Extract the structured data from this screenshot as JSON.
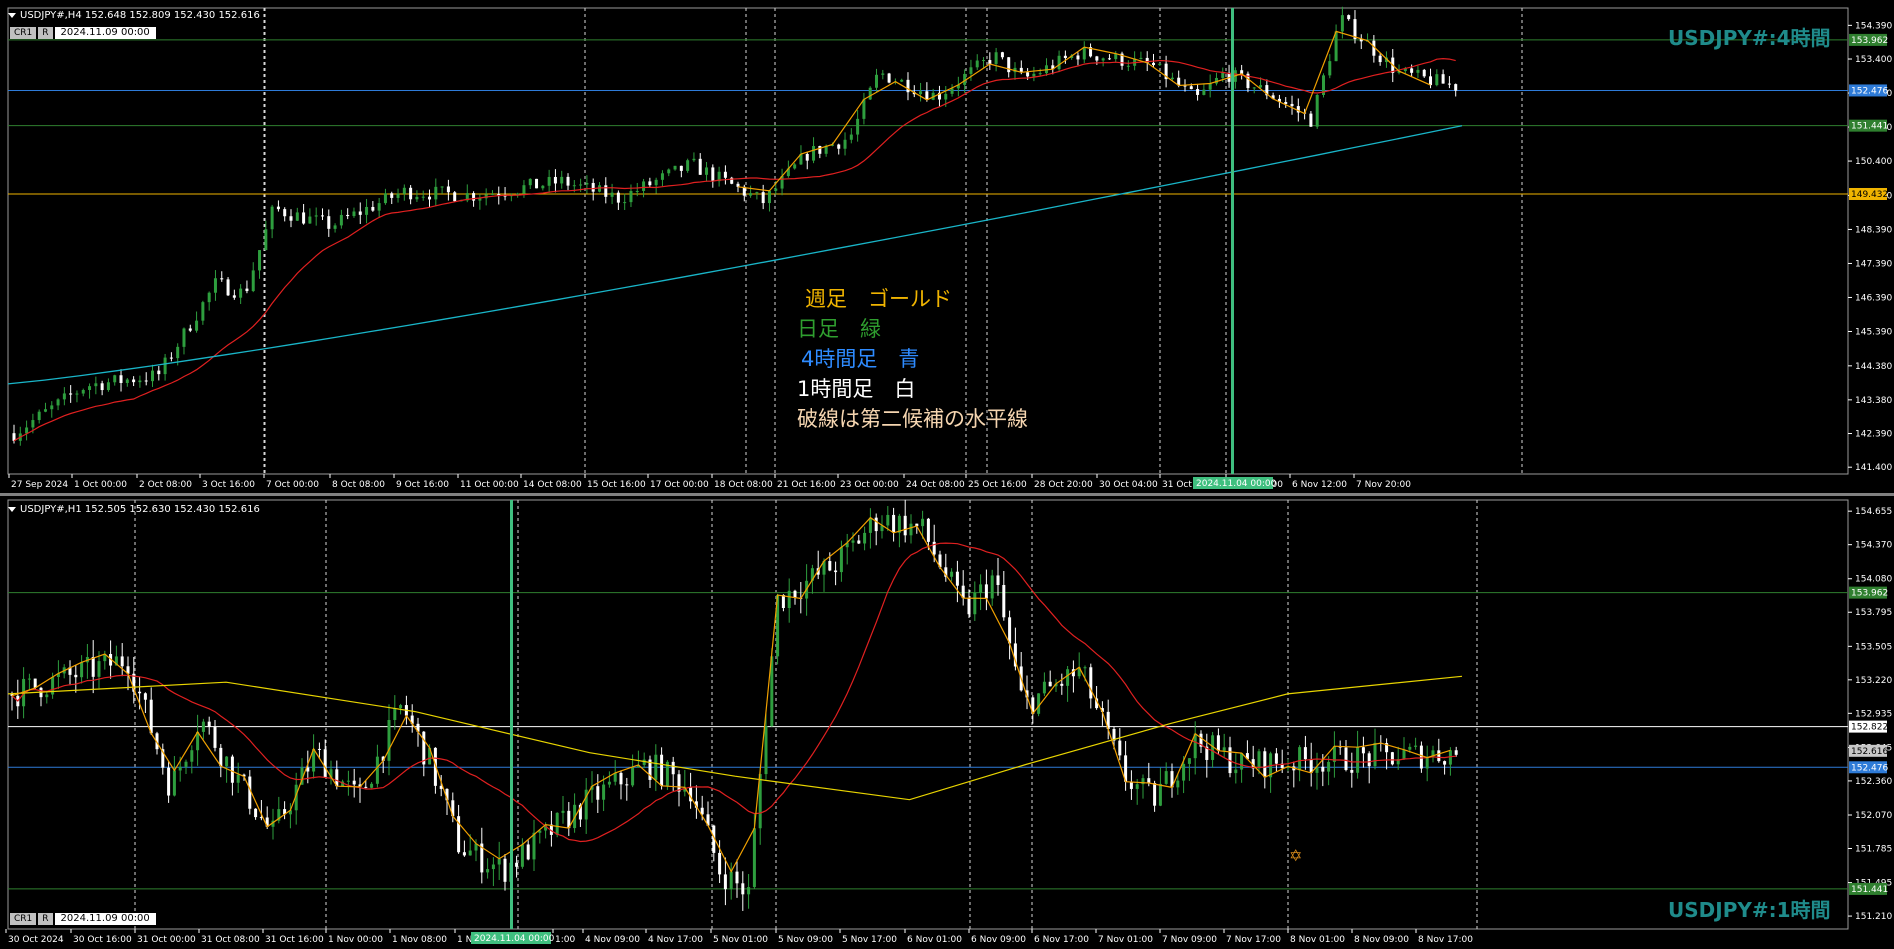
{
  "colors": {
    "bg": "#000000",
    "candle_up": "#2e9e3e",
    "candle_down": "#ffffff",
    "weekly_gold": "#f0b400",
    "daily_green": "#2f7f2f",
    "h4_blue": "#2e7bd8",
    "h1_white": "#ffffff",
    "ma_red": "#e02020",
    "ma_cyan": "#19b5c8",
    "ma_yellow": "#e8d400",
    "zigzag": "#f0a000",
    "marker": "#3fbf7f",
    "watermark": "#1f8b8b"
  },
  "top_pane": {
    "header": "USDJPY#,H4  152.648 152.809 152.430 152.616",
    "cr_label": "CR1",
    "r_label": "R",
    "cursor_datetime": "2024.11.09 00:00",
    "watermark": "USDJPY#:4時間",
    "marker_label": "2024.11.04 00:00",
    "y_ticks": [
      "154.390",
      "153.400",
      "152.400",
      "151.400",
      "150.400",
      "149.390",
      "148.390",
      "147.390",
      "146.390",
      "145.390",
      "144.380",
      "143.380",
      "142.390",
      "141.400"
    ],
    "price_tags": [
      {
        "value": "153.962",
        "color": "#2f7f2f",
        "text_color": "#ffffff"
      },
      {
        "value": "152.476",
        "color": "#2e7bd8",
        "text_color": "#ffffff"
      },
      {
        "value": "151.441",
        "color": "#2f7f2f",
        "text_color": "#ffffff"
      },
      {
        "value": "149.432",
        "color": "#f0b400",
        "text_color": "#000000"
      }
    ],
    "x_ticks": [
      "27 Sep 2024",
      "1 Oct 00:00",
      "2 Oct 08:00",
      "3 Oct 16:00",
      "7 Oct 00:00",
      "8 Oct 08:00",
      "9 Oct 16:00",
      "11 Oct 00:00",
      "14 Oct 08:00",
      "15 Oct 16:00",
      "17 Oct 00:00",
      "18 Oct 08:00",
      "21 Oct 16:00",
      "23 Oct 00:00",
      "24 Oct 08:00",
      "25 Oct 16:00",
      "28 Oct 20:00",
      "30 Oct 04:00",
      "31 Oct",
      "5 Nov 04:00",
      "6 Nov 12:00",
      "7 Nov 20:00"
    ],
    "legend": [
      {
        "text": "週足　ゴールド",
        "color": "#f0b400"
      },
      {
        "text": "日足　緑",
        "color": "#2f9f2f"
      },
      {
        "text": "4時間足　青",
        "color": "#2e8bff"
      },
      {
        "text": "1時間足　白",
        "color": "#ffffff"
      },
      {
        "text": "破線は第二候補の水平線",
        "color": "#f5d5b0"
      }
    ]
  },
  "bottom_pane": {
    "header": "USDJPY#,H1  152.505 152.630 152.430 152.616",
    "cr_label": "CR1",
    "r_label": "R",
    "cursor_datetime": "2024.11.09 00:00",
    "watermark": "USDJPY#:1時間",
    "marker_label": "2024.11.04 00:00",
    "y_ticks": [
      "154.655",
      "154.370",
      "154.080",
      "153.795",
      "153.505",
      "153.220",
      "152.935",
      "152.645",
      "152.360",
      "152.070",
      "151.785",
      "151.495",
      "151.210"
    ],
    "price_tags": [
      {
        "value": "153.962",
        "color": "#2f7f2f",
        "text_color": "#ffffff"
      },
      {
        "value": "152.822",
        "color": "#ffffff",
        "text_color": "#000000"
      },
      {
        "value": "152.616",
        "color": "#c8c8c8",
        "text_color": "#000000"
      },
      {
        "value": "152.476",
        "color": "#2e7bd8",
        "text_color": "#ffffff"
      },
      {
        "value": "151.441",
        "color": "#2f7f2f",
        "text_color": "#ffffff"
      }
    ],
    "x_ticks": [
      "30 Oct 2024",
      "30 Oct 16:00",
      "31 Oct 00:00",
      "31 Oct 08:00",
      "31 Oct 16:00",
      "1 Nov 00:00",
      "1 Nov 08:00",
      "1 N",
      "1:00",
      "4 Nov 09:00",
      "4 Nov 17:00",
      "5 Nov 01:00",
      "5 Nov 09:00",
      "5 Nov 17:00",
      "6 Nov 01:00",
      "6 Nov 09:00",
      "6 Nov 17:00",
      "7 Nov 01:00",
      "7 Nov 09:00",
      "7 Nov 17:00",
      "8 Nov 01:00",
      "8 Nov 09:00",
      "8 Nov 17:00"
    ]
  }
}
